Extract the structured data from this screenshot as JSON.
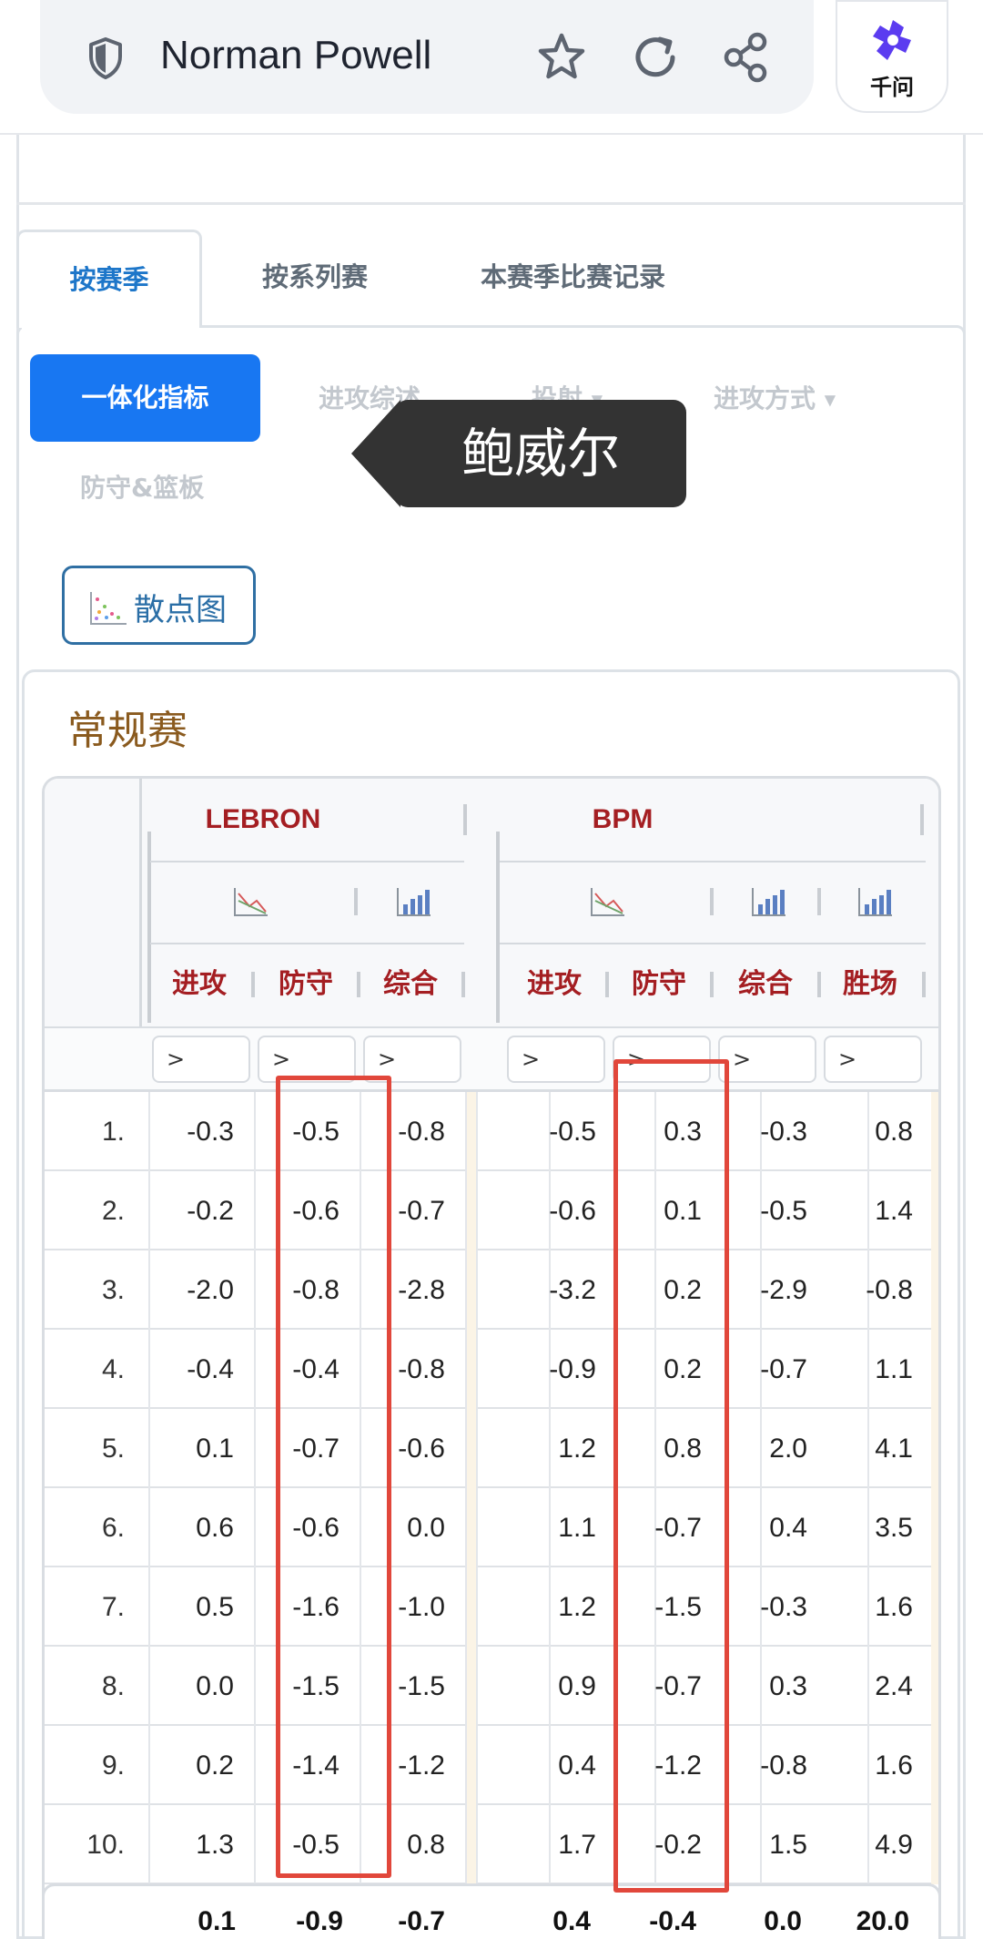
{
  "browser": {
    "title": "Norman Powell",
    "qianwen_label": "千问",
    "icons": [
      "shield-icon",
      "star-icon",
      "refresh-icon",
      "share-icon",
      "qianwen-logo-icon"
    ]
  },
  "tabs": [
    {
      "label": "按赛季",
      "active": true
    },
    {
      "label": "按系列赛",
      "active": false
    },
    {
      "label": "本赛季比赛记录",
      "active": false
    }
  ],
  "subtabs": [
    {
      "label": "一体化指标",
      "active": true
    },
    {
      "label": "进攻综述"
    },
    {
      "label": "投射"
    },
    {
      "label": "进攻方式"
    },
    {
      "label": "防守&篮板"
    }
  ],
  "tooltip": "鲍威尔",
  "scatter_button": "散点图",
  "section_title": "常规赛",
  "table": {
    "groups": [
      "LEBRON",
      "BPM"
    ],
    "columns": [
      "进攻",
      "防守",
      "综合",
      "进攻",
      "防守",
      "综合",
      "胜场"
    ],
    "filter_placeholder": ">",
    "rows": [
      {
        "rank": "1.",
        "values": [
          "-0.3",
          "-0.5",
          "-0.8",
          "-0.5",
          "0.3",
          "-0.3",
          "0.8"
        ]
      },
      {
        "rank": "2.",
        "values": [
          "-0.2",
          "-0.6",
          "-0.7",
          "-0.6",
          "0.1",
          "-0.5",
          "1.4"
        ]
      },
      {
        "rank": "3.",
        "values": [
          "-2.0",
          "-0.8",
          "-2.8",
          "-3.2",
          "0.2",
          "-2.9",
          "-0.8"
        ]
      },
      {
        "rank": "4.",
        "values": [
          "-0.4",
          "-0.4",
          "-0.8",
          "-0.9",
          "0.2",
          "-0.7",
          "1.1"
        ]
      },
      {
        "rank": "5.",
        "values": [
          "0.1",
          "-0.7",
          "-0.6",
          "1.2",
          "0.8",
          "2.0",
          "4.1"
        ]
      },
      {
        "rank": "6.",
        "values": [
          "0.6",
          "-0.6",
          "0.0",
          "1.1",
          "-0.7",
          "0.4",
          "3.5"
        ]
      },
      {
        "rank": "7.",
        "values": [
          "0.5",
          "-1.6",
          "-1.0",
          "1.2",
          "-1.5",
          "-0.3",
          "1.6"
        ]
      },
      {
        "rank": "8.",
        "values": [
          "0.0",
          "-1.5",
          "-1.5",
          "0.9",
          "-0.7",
          "0.3",
          "2.4"
        ]
      },
      {
        "rank": "9.",
        "values": [
          "0.2",
          "-1.4",
          "-1.2",
          "0.4",
          "-1.2",
          "-0.8",
          "1.6"
        ]
      },
      {
        "rank": "10.",
        "values": [
          "1.3",
          "-0.5",
          "0.8",
          "1.7",
          "-0.2",
          "1.5",
          "4.9"
        ]
      }
    ],
    "totals": [
      "0.1",
      "-0.9",
      "-0.7",
      "0.4",
      "-0.4",
      "0.0",
      "20.0"
    ]
  },
  "colors": {
    "accent": "#1877f2",
    "header_red": "#a41e22",
    "highlight": "#e1473b",
    "tooltip_bg": "#333333"
  }
}
